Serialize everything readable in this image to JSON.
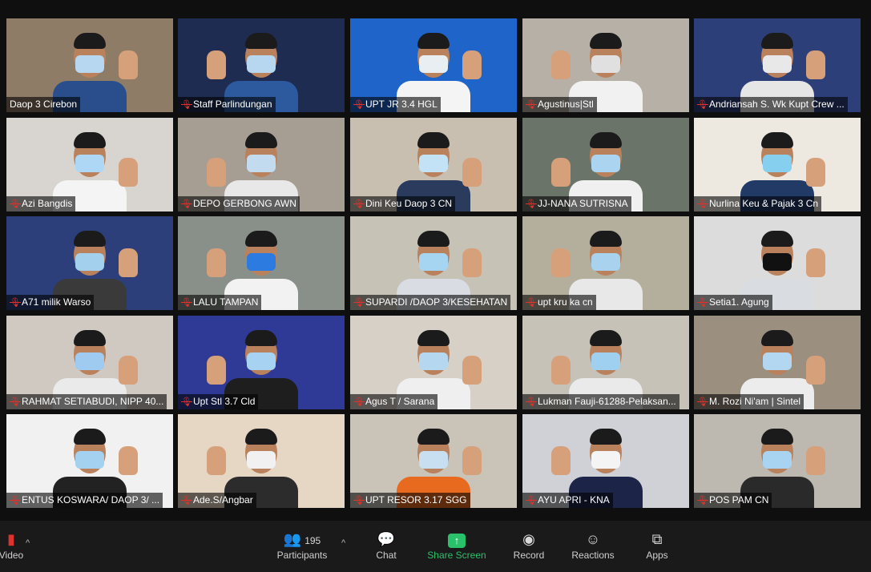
{
  "tiles": [
    {
      "name": "Daop 3 Cirebon",
      "muted": false,
      "active": true,
      "bg": "#8e7c66",
      "shirt": "#2a4e8c",
      "mask": "#b7d7f1"
    },
    {
      "name": "Staff Parlindungan",
      "muted": true,
      "active": false,
      "bg": "#1e2c52",
      "shirt": "#2d5a9e",
      "mask": "#b7d7f1"
    },
    {
      "name": "UPT JR 3.4 HGL",
      "muted": true,
      "active": false,
      "bg": "#1f64c9",
      "shirt": "#f4f4f4",
      "mask": "#e8eef2"
    },
    {
      "name": "Agustinus|Stl",
      "muted": true,
      "active": false,
      "bg": "#b7b0a6",
      "shirt": "#f1f1f1",
      "mask": "#e0e0e0"
    },
    {
      "name": "Andriansah S. Wk Kupt Crew ...",
      "muted": true,
      "active": false,
      "bg": "#2d3f79",
      "shirt": "#e6e6e6",
      "mask": "#e8e8e8"
    },
    {
      "name": "Azi Bangdis",
      "muted": true,
      "active": false,
      "bg": "#d8d4cf",
      "shirt": "#f4f4f4",
      "mask": "#aed7f5"
    },
    {
      "name": "DEPO GERBONG AWN",
      "muted": true,
      "active": false,
      "bg": "#a79e93",
      "shirt": "#e8e8e8",
      "mask": "#c3dbee"
    },
    {
      "name": "Dini Keu Daop 3 CN",
      "muted": true,
      "active": false,
      "bg": "#c9bfb1",
      "shirt": "#2a3b5d",
      "mask": "#c4e2f5"
    },
    {
      "name": "JJ-NANA SUTRISNA",
      "muted": true,
      "active": false,
      "bg": "#6b7469",
      "shirt": "#f0f0f0",
      "mask": "#aad4f0"
    },
    {
      "name": "Nurlina Keu & Pajak 3 Cn",
      "muted": true,
      "active": false,
      "bg": "#ede8e0",
      "shirt": "#223a66",
      "mask": "#86cfef"
    },
    {
      "name": "A71 milik Warso",
      "muted": true,
      "active": false,
      "bg": "#2c3f7a",
      "shirt": "#3a3a3a",
      "mask": "#a3d0ec"
    },
    {
      "name": "LALU TAMPAN",
      "muted": true,
      "active": false,
      "bg": "#89908a",
      "shirt": "#f2f2f2",
      "mask": "#2b7be0"
    },
    {
      "name": "SUPARDI /DAOP 3/KESEHATAN",
      "muted": true,
      "active": false,
      "bg": "#c6c2b6",
      "shirt": "#d9dde3",
      "mask": "#a6d5f1"
    },
    {
      "name": "upt kru ka cn",
      "muted": true,
      "active": false,
      "bg": "#b4ae9d",
      "shirt": "#e8e8e8",
      "mask": "#a9d2ef"
    },
    {
      "name": "Setia1. Agung",
      "muted": true,
      "active": false,
      "bg": "#dcdcdc",
      "shirt": "#d9dde2",
      "mask": "#111111"
    },
    {
      "name": "RAHMAT SETIABUDI, NIPP 40...",
      "muted": true,
      "active": false,
      "bg": "#cfc9c2",
      "shirt": "#eaeaea",
      "mask": "#9ecbef"
    },
    {
      "name": "Upt Stl 3.7 Cld",
      "muted": true,
      "active": false,
      "bg": "#2f3a96",
      "shirt": "#1e1e1e",
      "mask": "#a8d2f1"
    },
    {
      "name": "Agus T / Sarana",
      "muted": true,
      "active": false,
      "bg": "#d6d0c7",
      "shirt": "#efefef",
      "mask": "#b5d8f0"
    },
    {
      "name": "Lukman Fauji-61288-Pelaksan...",
      "muted": true,
      "active": false,
      "bg": "#c7c2b8",
      "shirt": "#eaeaea",
      "mask": "#9fd0f0"
    },
    {
      "name": "M. Rozi Ni'am | Sintel",
      "muted": true,
      "active": false,
      "bg": "#9b8f80",
      "shirt": "#ececec",
      "mask": "#b3d7f1"
    },
    {
      "name": "ENTUS KOSWARA/ DAOP 3/ ...",
      "muted": true,
      "active": false,
      "bg": "#f1f1f1",
      "shirt": "#222222",
      "mask": "#a5d1f0"
    },
    {
      "name": "Ade.S/Angbar",
      "muted": true,
      "active": false,
      "bg": "#e5d7c4",
      "shirt": "#2c2c2c",
      "mask": "#f1f1f1"
    },
    {
      "name": "UPT RESOR 3.17 SGG",
      "muted": true,
      "active": false,
      "bg": "#c9c3b8",
      "shirt": "#e86a1f",
      "mask": "#c7dff1"
    },
    {
      "name": "AYU APRI - KNA",
      "muted": true,
      "active": false,
      "bg": "#cfd1d6",
      "shirt": "#1c2447",
      "mask": "#f4f4f4"
    },
    {
      "name": "POS PAM CN",
      "muted": true,
      "active": false,
      "bg": "#bdb8b0",
      "shirt": "#2a2a2a",
      "mask": "#a9d4f1"
    }
  ],
  "toolbar": {
    "video_label": "Video",
    "participants_label": "Participants",
    "participants_count": "195",
    "chat_label": "Chat",
    "share_label": "Share Screen",
    "record_label": "Record",
    "reactions_label": "Reactions",
    "apps_label": "Apps"
  }
}
